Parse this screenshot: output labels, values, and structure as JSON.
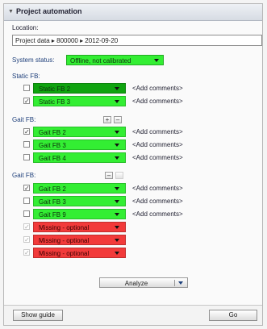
{
  "window": {
    "title": "Project automation"
  },
  "location": {
    "label": "Location:",
    "value": "Project data  ▸  800000  ▸  2012-09-20"
  },
  "system_status": {
    "label": "System status:",
    "value": "Offline, not calibrated",
    "color": "#33ee33"
  },
  "static_fb": {
    "label": "Static FB:",
    "rows": [
      {
        "checked": false,
        "value": "Static FB 2",
        "color": "#0fa30f",
        "comment": "<Add comments>"
      },
      {
        "checked": true,
        "value": "Static FB 3",
        "color": "#33ee33",
        "comment": "<Add comments>"
      }
    ]
  },
  "gait_fb_1": {
    "label": "Gait FB:",
    "rows": [
      {
        "checked": true,
        "value": "Gait FB 2",
        "color": "#33ee33",
        "comment": "<Add comments>"
      },
      {
        "checked": false,
        "value": "Gait FB 3",
        "color": "#33ee33",
        "comment": "<Add comments>"
      },
      {
        "checked": false,
        "value": "Gait FB 4",
        "color": "#33ee33",
        "comment": "<Add comments>"
      }
    ]
  },
  "gait_fb_2": {
    "label": "Gait FB:",
    "rows": [
      {
        "checked": true,
        "value": "Gait FB 2",
        "color": "#33ee33",
        "comment": "<Add comments>"
      },
      {
        "checked": false,
        "value": "Gait FB 3",
        "color": "#33ee33",
        "comment": "<Add comments>"
      },
      {
        "checked": false,
        "value": "Gait FB 9",
        "color": "#33ee33",
        "comment": "<Add comments>"
      }
    ],
    "missing_rows": [
      {
        "checked": true,
        "value": "Missing - optional",
        "color": "#f23a3a"
      },
      {
        "checked": true,
        "value": "Missing - optional",
        "color": "#f23a3a"
      },
      {
        "checked": true,
        "value": "Missing - optional",
        "color": "#f23a3a"
      }
    ]
  },
  "controls": {
    "add_symbol": "+",
    "remove_symbol": "–",
    "check_mark": "✓"
  },
  "analyze": {
    "label": "Analyze"
  },
  "footer": {
    "show_guide": "Show guide",
    "go": "Go"
  }
}
